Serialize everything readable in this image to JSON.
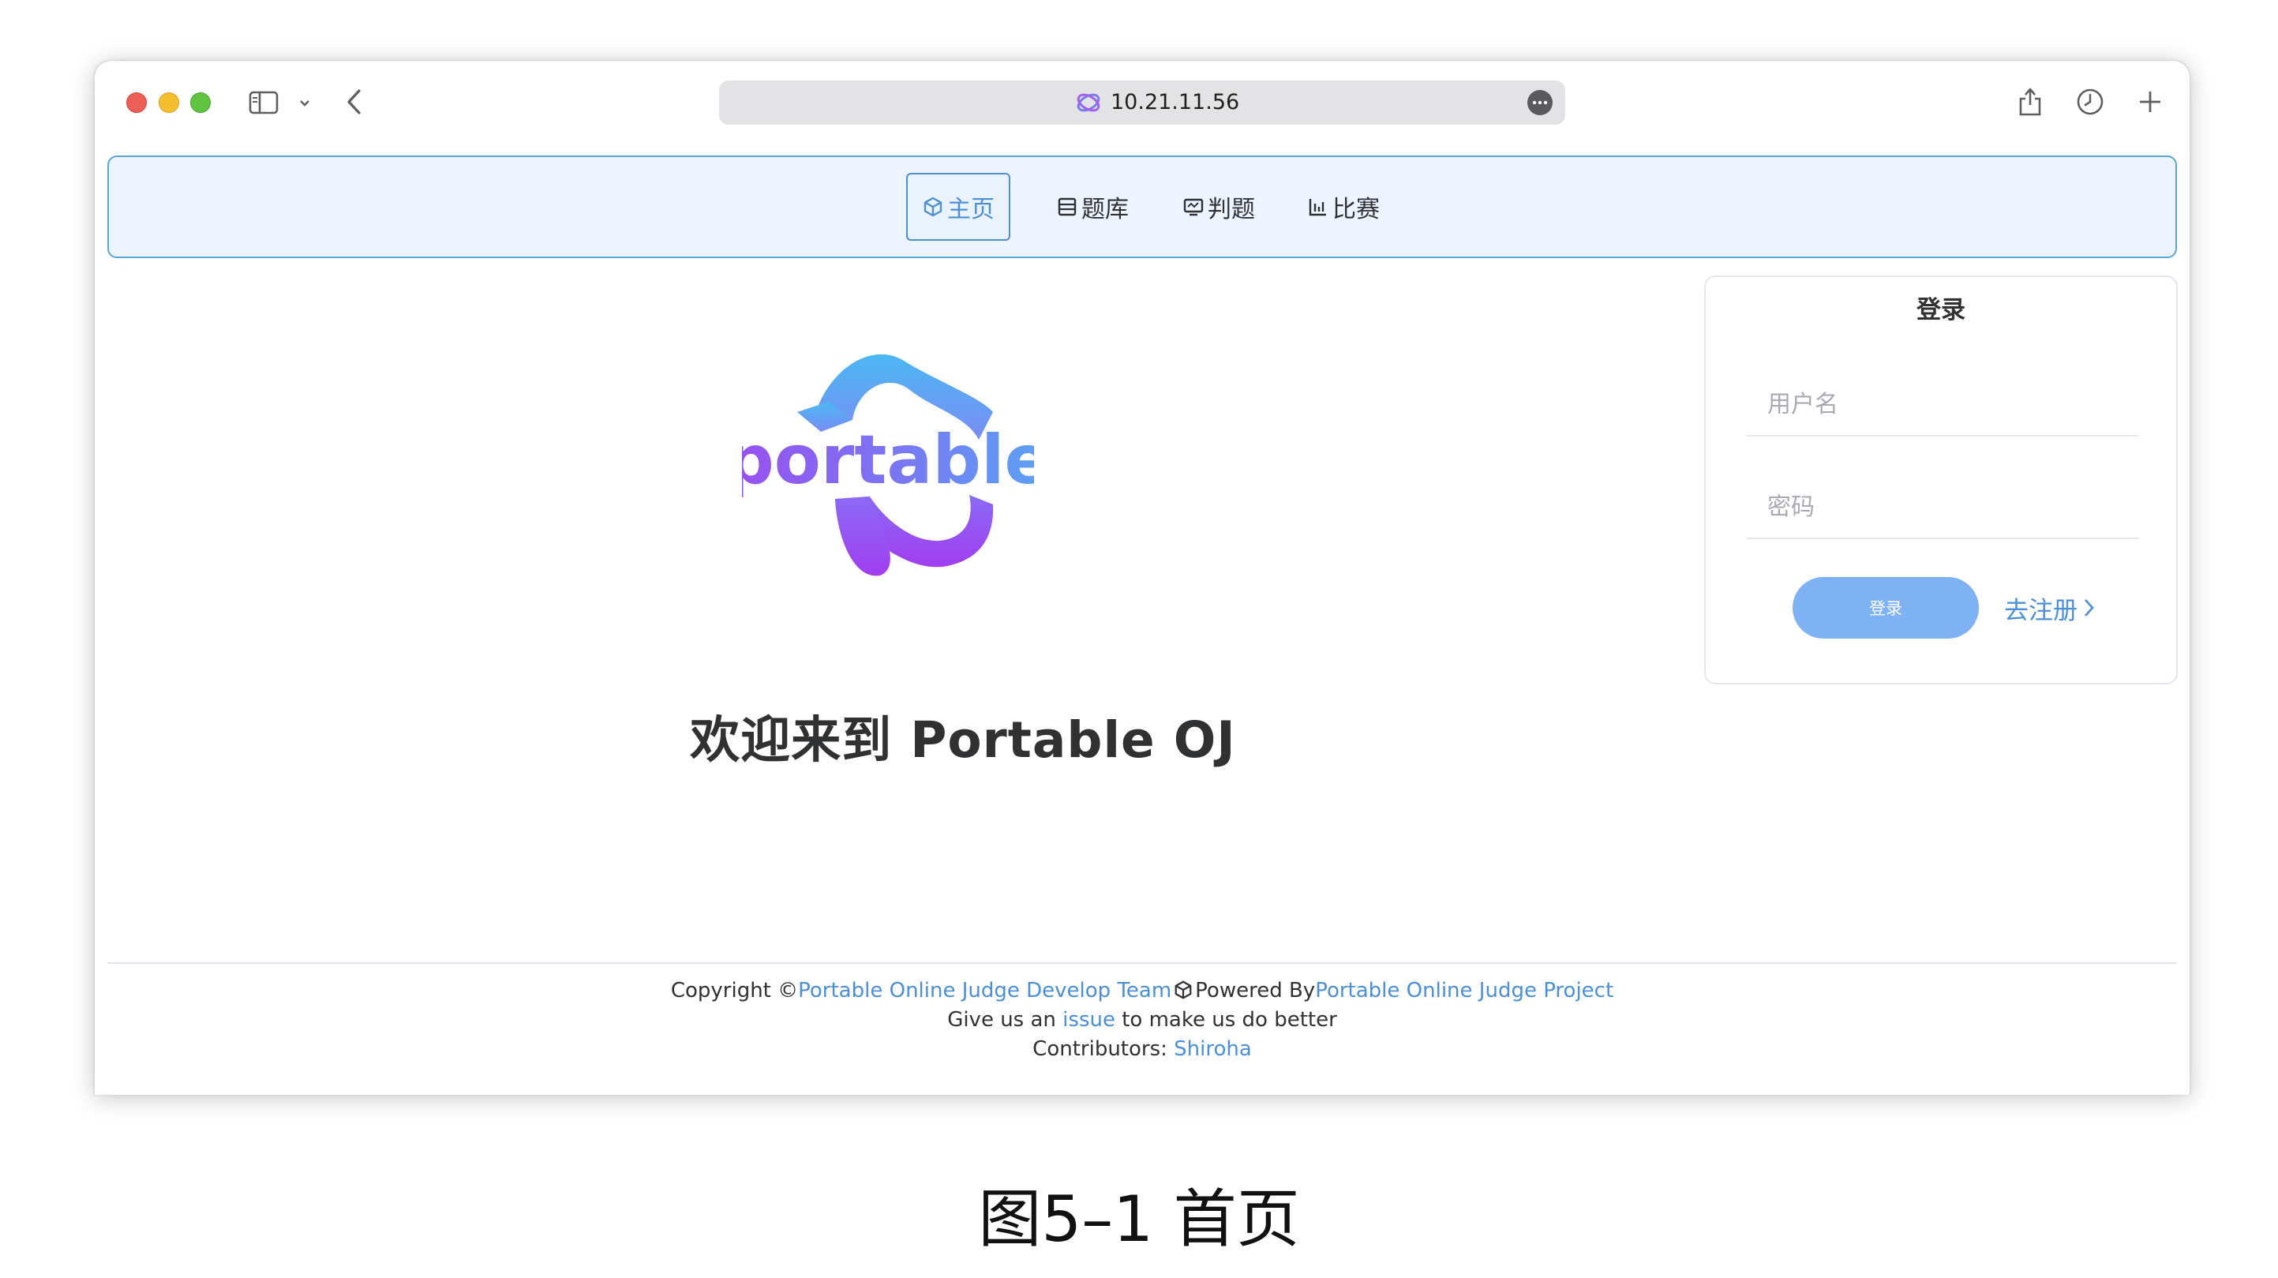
{
  "browser": {
    "url": "10.21.11.56",
    "icons": [
      "sidebar-toggle-icon",
      "chevron-down-icon",
      "back-arrow-icon",
      "more-icon",
      "share-icon",
      "history-clock-icon",
      "new-tab-plus-icon"
    ]
  },
  "nav": {
    "items": [
      {
        "label": "主页",
        "icon": "cube-icon",
        "active": true
      },
      {
        "label": "题库",
        "icon": "database-icon",
        "active": false
      },
      {
        "label": "判题",
        "icon": "monitor-icon",
        "active": false
      },
      {
        "label": "比赛",
        "icon": "trophy-chart-icon",
        "active": false
      }
    ],
    "active_color": "#4c8fd9"
  },
  "main": {
    "logo_text": "portable",
    "welcome": "欢迎来到 Portable OJ"
  },
  "login": {
    "title": "登录",
    "username_placeholder": "用户名",
    "password_placeholder": "密码",
    "submit_label": "登录",
    "register_label": "去注册",
    "button_color": "#7fb2f4"
  },
  "footer": {
    "copyright_prefix": "Copyright ©",
    "team_link": "Portable Online Judge Develop Team",
    "powered_by": "Powered By",
    "project_link": "Portable Online Judge Project",
    "issue_prefix": "Give us an ",
    "issue_link": "issue",
    "issue_suffix": " to make us do better",
    "contributors_prefix": "Contributors: ",
    "contributor": "Shiroha"
  },
  "caption": "图5–1 首页"
}
